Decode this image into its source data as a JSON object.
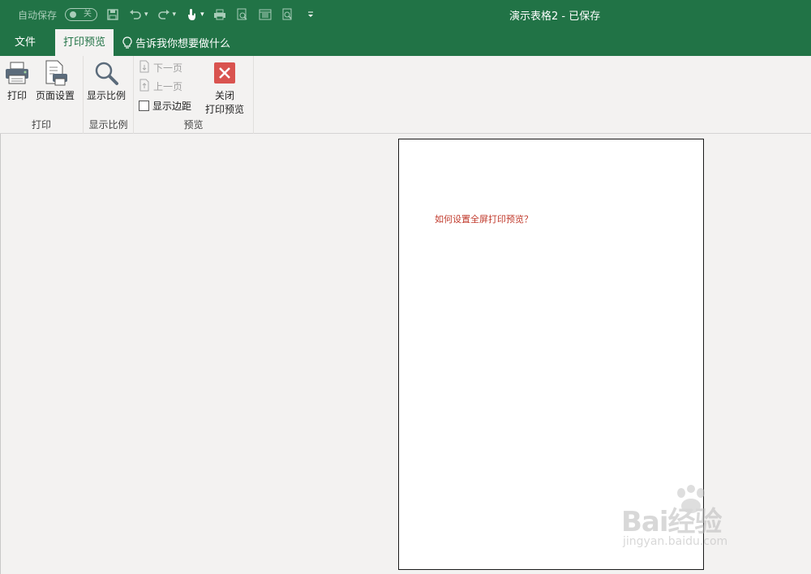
{
  "quick_access": {
    "autosave_label": "自动保存",
    "autosave_state": "关",
    "icons": [
      "save-icon",
      "undo-icon",
      "redo-icon",
      "touch-mode-icon",
      "print-icon",
      "print-preview-icon",
      "page-layout-icon",
      "zoom-icon",
      "customize-icon"
    ]
  },
  "window": {
    "title": "演示表格2  -  已保存"
  },
  "tabs": {
    "file": "文件",
    "active": "打印预览",
    "tell_me": "告诉我你想要做什么"
  },
  "ribbon": {
    "print_group": {
      "label": "打印",
      "print": "打印",
      "page_setup": "页面设置"
    },
    "zoom_group": {
      "label": "显示比例",
      "zoom": "显示比例"
    },
    "preview_group": {
      "label": "预览",
      "next_page": "下一页",
      "prev_page": "上一页",
      "show_margins": "显示边距",
      "close_line1": "关闭",
      "close_line2": "打印预览"
    }
  },
  "page": {
    "cell_text": "如何设置全屏打印预览？"
  },
  "watermark": {
    "main": "Bai经验",
    "sub": "jingyan.baidu.com"
  },
  "colors": {
    "brand_green": "#217346",
    "close_red": "#d9534f",
    "cell_text": "#c0392b"
  }
}
